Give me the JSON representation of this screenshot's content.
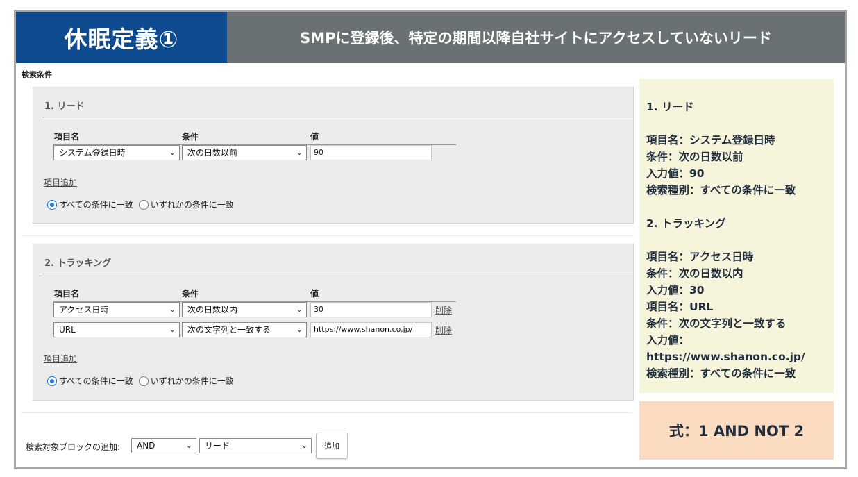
{
  "header": {
    "title": "休眠定義①",
    "subtitle": "SMPに登録後、特定の期間以降自社サイトにアクセスしていないリード"
  },
  "search_label": "検索条件",
  "columns": {
    "item": "項目名",
    "condition": "条件",
    "value": "値"
  },
  "blocks": [
    {
      "title": "1. リード",
      "rows": [
        {
          "item": "システム登録日時",
          "condition": "次の日数以前",
          "value": "90"
        }
      ],
      "add_item": "項目追加",
      "radio_all": "すべての条件に一致",
      "radio_any": "いずれかの条件に一致"
    },
    {
      "title": "2. トラッキング",
      "rows": [
        {
          "item": "アクセス日時",
          "condition": "次の日数以内",
          "value": "30",
          "delete": "削除"
        },
        {
          "item": "URL",
          "condition": "次の文字列と一致する",
          "value": "https://www.shanon.co.jp/",
          "delete": "削除"
        }
      ],
      "add_item": "項目追加",
      "radio_all": "すべての条件に一致",
      "radio_any": "いずれかの条件に一致"
    }
  ],
  "bottom": {
    "label": "検索対象ブロックの追加:",
    "operator": "AND",
    "block": "リード",
    "add_button": "追加"
  },
  "notes": {
    "b1_title": "1. リード",
    "b1_item": "項目名：システム登録日時",
    "b1_cond": "条件：次の日数以前",
    "b1_value": "入力値：90",
    "b1_type": "検索種別：すべての条件に一致",
    "b2_title": "2. トラッキング",
    "b2_item1": "項目名：アクセス日時",
    "b2_cond1": "条件：次の日数以内",
    "b2_value1": "入力値：30",
    "b2_item2": "項目名：URL",
    "b2_cond2": "条件：次の文字列と一致する",
    "b2_value2_label": "入力値：",
    "b2_value2": "https://www.shanon.co.jp/",
    "b2_type": "検索種別：すべての条件に一致"
  },
  "formula": "式：1 AND NOT 2",
  "colors": {
    "title_bg": "#0e4a8f",
    "subtitle_bg": "#6a7173",
    "notes_bg": "#f7f4dc",
    "formula_bg": "#fbdcc0",
    "radio_accent": "#1a73e8"
  }
}
